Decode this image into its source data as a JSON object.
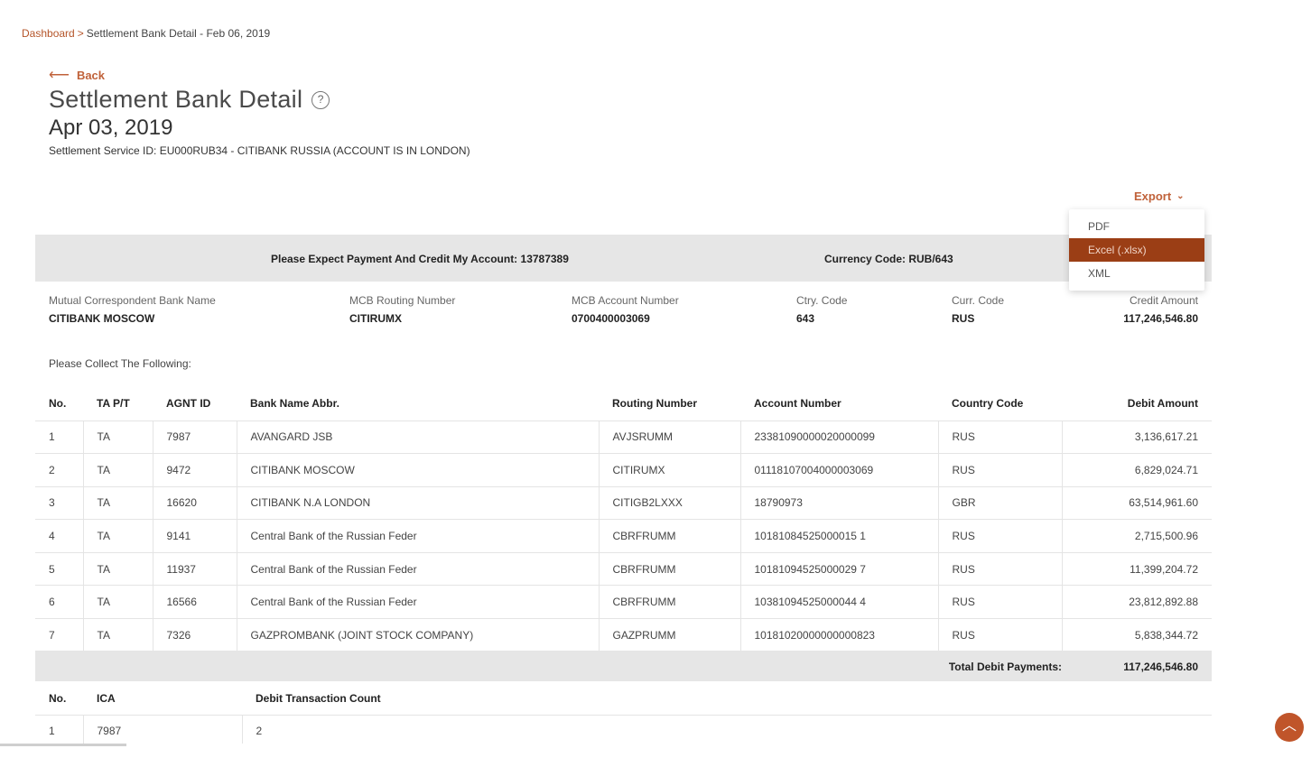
{
  "breadcrumb": {
    "home": "Dashboard",
    "separator": ">",
    "current": "Settlement Bank Detail - Feb 06, 2019"
  },
  "back": {
    "icon": "left-arrow-icon",
    "label": "Back"
  },
  "page": {
    "title": "Settlement Bank Detail",
    "help_icon": "help-icon",
    "date": "Apr 03, 2019",
    "service_id": "Settlement Service ID: EU000RUB34 - CITIBANK RUSSIA (ACCOUNT IS IN LONDON)"
  },
  "export": {
    "label": "Export",
    "options": [
      "PDF",
      "Excel (.xlsx)",
      "XML"
    ],
    "selected": "Excel (.xlsx)"
  },
  "band": {
    "expect": "Please Expect Payment And Credit My Account: 13787389",
    "currency": "Currency Code: RUB/643"
  },
  "mcb": {
    "bank_name": {
      "label": "Mutual Correspondent Bank Name",
      "value": "CITIBANK MOSCOW"
    },
    "routing": {
      "label": "MCB Routing Number",
      "value": "CITIRUMX"
    },
    "account": {
      "label": "MCB Account Number",
      "value": "0700400003069"
    },
    "ctry": {
      "label": "Ctry. Code",
      "value": "643"
    },
    "curr": {
      "label": "Curr. Code",
      "value": "RUS"
    },
    "credit": {
      "label": "Credit Amount",
      "value": "117,246,546.80"
    }
  },
  "collect_label": "Please Collect The Following:",
  "table": {
    "headers": [
      "No.",
      "TA P/T",
      "AGNT ID",
      "Bank Name Abbr.",
      "Routing Number",
      "Account Number",
      "Country Code",
      "Debit Amount"
    ],
    "rows": [
      [
        "1",
        "TA",
        "7987",
        "AVANGARD JSB",
        "AVJSRUMM",
        "23381090000020000099",
        "RUS",
        "3,136,617.21"
      ],
      [
        "2",
        "TA",
        "9472",
        "CITIBANK MOSCOW",
        "CITIRUMX",
        "01118107004000003069",
        "RUS",
        "6,829,024.71"
      ],
      [
        "3",
        "TA",
        "16620",
        "CITIBANK N.A LONDON",
        "CITIGB2LXXX",
        "18790973",
        "GBR",
        "63,514,961.60"
      ],
      [
        "4",
        "TA",
        "9141",
        "Central Bank of the Russian Feder",
        "CBRFRUMM",
        "10181084525000015 1",
        "RUS",
        "2,715,500.96"
      ],
      [
        "5",
        "TA",
        "11937",
        "Central Bank of the Russian Feder",
        "CBRFRUMM",
        "10181094525000029 7",
        "RUS",
        "11,399,204.72"
      ],
      [
        "6",
        "TA",
        "16566",
        "Central Bank of the Russian Feder",
        "CBRFRUMM",
        "10381094525000044 4",
        "RUS",
        "23,812,892.88"
      ],
      [
        "7",
        "TA",
        "7326",
        "GAZPROMBANK (JOINT STOCK COMPANY)",
        "GAZPRUMM",
        "10181020000000000823",
        "RUS",
        "5,838,344.72"
      ]
    ]
  },
  "total": {
    "label": "Total Debit Payments:",
    "value": "117,246,546.80"
  },
  "ica_table": {
    "headers": [
      "No.",
      "ICA",
      "Debit Transaction Count"
    ],
    "rows": [
      [
        "1",
        "7987",
        "2"
      ]
    ]
  },
  "scroll_top_icon": "chevron-up-icon",
  "colors": {
    "accent": "#c0623a",
    "selected": "#9b3e15",
    "band": "#e6e6e6"
  }
}
